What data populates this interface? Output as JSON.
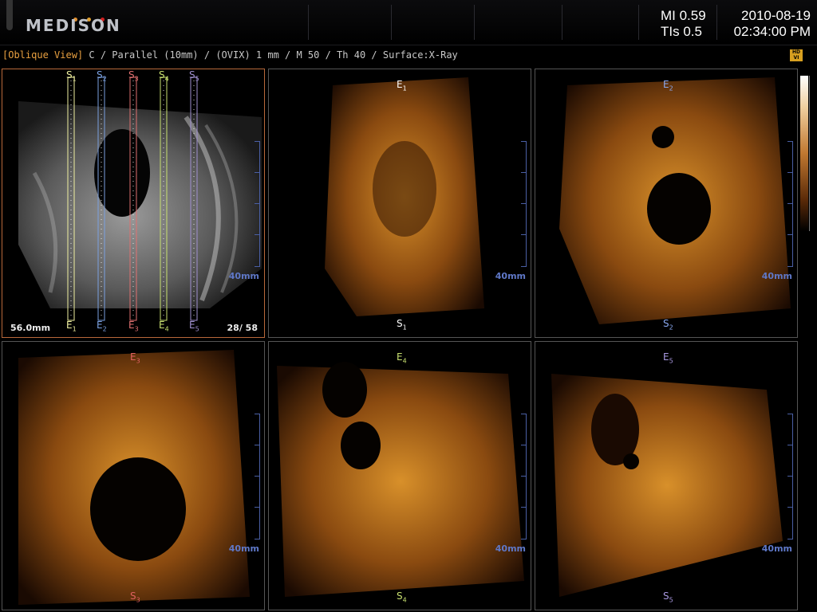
{
  "header": {
    "brand": "MEDISON",
    "mi_label": "MI 0.59",
    "tis_label": "TIs 0.5",
    "date": "2010-08-19",
    "time": "02:34:00 PM",
    "logo_dot_colors": [
      "#e09030",
      "#e0a030",
      "#d02020"
    ]
  },
  "status": {
    "mode": "[Oblique View]",
    "params": "C / Parallel (10mm) / (OVIX) 1 mm / M 50 / Th 40 / Surface:X-Ray"
  },
  "badge": {
    "line1": "HD",
    "line2": "VI"
  },
  "reference_pane": {
    "depth": "56.0mm",
    "frame": "28/ 58",
    "lines": [
      {
        "start": "S",
        "end": "E",
        "index": "1",
        "color": "#f0f0a0"
      },
      {
        "start": "S",
        "end": "E",
        "index": "2",
        "color": "#7aa0e0"
      },
      {
        "start": "S",
        "end": "E",
        "index": "3",
        "color": "#e07070"
      },
      {
        "start": "S",
        "end": "E",
        "index": "4",
        "color": "#c8e070"
      },
      {
        "start": "S",
        "end": "E",
        "index": "5",
        "color": "#a090d0"
      }
    ]
  },
  "slices": [
    {
      "top": "E",
      "top_idx": "1",
      "bottom": "S",
      "bottom_idx": "1",
      "color": "#ffffff",
      "scale": "40mm"
    },
    {
      "top": "E",
      "top_idx": "2",
      "bottom": "S",
      "bottom_idx": "2",
      "color": "#8aa8f0",
      "scale": "40mm"
    },
    {
      "top": "E",
      "top_idx": "3",
      "bottom": "S",
      "bottom_idx": "3",
      "color": "#e06060",
      "scale": "40mm"
    },
    {
      "top": "E",
      "top_idx": "4",
      "bottom": "S",
      "bottom_idx": "4",
      "color": "#c8e070",
      "scale": "40mm"
    },
    {
      "top": "E",
      "top_idx": "5",
      "bottom": "S",
      "bottom_idx": "5",
      "color": "#a898e0",
      "scale": "40mm"
    }
  ],
  "reference_scale": "40mm"
}
